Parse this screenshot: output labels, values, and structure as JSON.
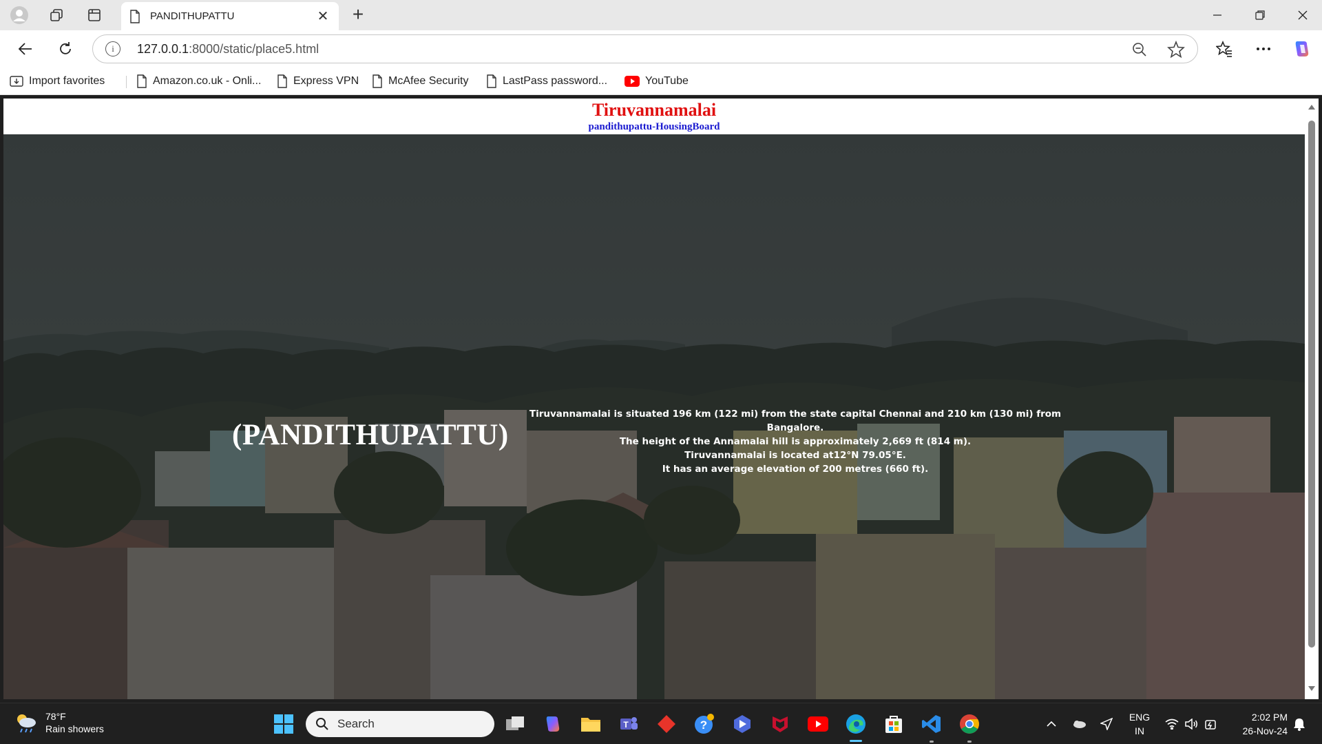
{
  "browser": {
    "tab_title": "PANDITHUPATTU",
    "url_host": "127.0.0.1",
    "url_rest": ":8000/static/place5.html",
    "favorites": [
      {
        "label": "Import favorites",
        "icon": "import-icon"
      },
      {
        "label": "Amazon.co.uk - Onli...",
        "icon": "page-icon"
      },
      {
        "label": "Express VPN",
        "icon": "page-icon"
      },
      {
        "label": "McAfee Security",
        "icon": "page-icon"
      },
      {
        "label": "LastPass password...",
        "icon": "page-icon"
      },
      {
        "label": "YouTube",
        "icon": "youtube-icon"
      }
    ]
  },
  "page": {
    "header_title": "Tiruvannamalai",
    "header_subtitle": "pandithupattu-HousingBoard",
    "hero_title": "(PANDITHUPATTU)",
    "hero_lines": [
      "Tiruvannamalai is situated 196 km (122 mi) from the state capital Chennai and 210 km (130 mi) from Bangalore.",
      "The height of the Annamalai hill is approximately 2,669 ft (814 m).",
      "Tiruvannamalai is located at12°N 79.05°E.",
      "It has an average elevation of 200 metres (660 ft)."
    ]
  },
  "taskbar": {
    "weather_temp": "78°F",
    "weather_desc": "Rain showers",
    "search_placeholder": "Search",
    "lang_top": "ENG",
    "lang_bottom": "IN",
    "time": "2:02 PM",
    "date": "26-Nov-24"
  },
  "colors": {
    "header_title": "#e01010",
    "header_subtitle": "#1a1ad0",
    "taskbar_bg": "#202020"
  }
}
